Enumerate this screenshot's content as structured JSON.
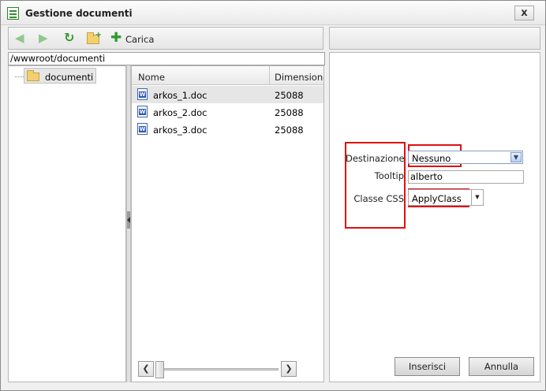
{
  "window": {
    "title": "Gestione documenti",
    "close_label": "x"
  },
  "toolbar": {
    "back_icon": "arrow-left-icon",
    "forward_icon": "arrow-right-icon",
    "refresh_icon": "refresh-icon",
    "new_folder_icon": "new-folder-icon",
    "upload_icon": "plus-icon",
    "upload_label": "Carica"
  },
  "path": {
    "value": "/wwwroot/documenti"
  },
  "tree": {
    "items": [
      {
        "label": "documenti",
        "icon": "folder-icon"
      }
    ]
  },
  "file_list": {
    "columns": [
      "Nome",
      "Dimensione"
    ],
    "rows": [
      {
        "name": "arkos_1.doc",
        "size": "25088",
        "icon": "word-doc-icon",
        "selected": true
      },
      {
        "name": "arkos_2.doc",
        "size": "25088",
        "icon": "word-doc-icon",
        "selected": false
      },
      {
        "name": "arkos_3.doc",
        "size": "25088",
        "icon": "word-doc-icon",
        "selected": false
      }
    ]
  },
  "properties": {
    "destinazione": {
      "label": "Destinazione",
      "value": "Nessuno"
    },
    "tooltip": {
      "label": "Tooltip",
      "value": "alberto"
    },
    "classe_css": {
      "label": "Classe CSS",
      "value": "ApplyClass"
    }
  },
  "actions": {
    "insert_label": "Inserisci",
    "cancel_label": "Annulla"
  },
  "colors": {
    "highlight_box": "#e01010",
    "selected_row": "#e6e6e6"
  }
}
